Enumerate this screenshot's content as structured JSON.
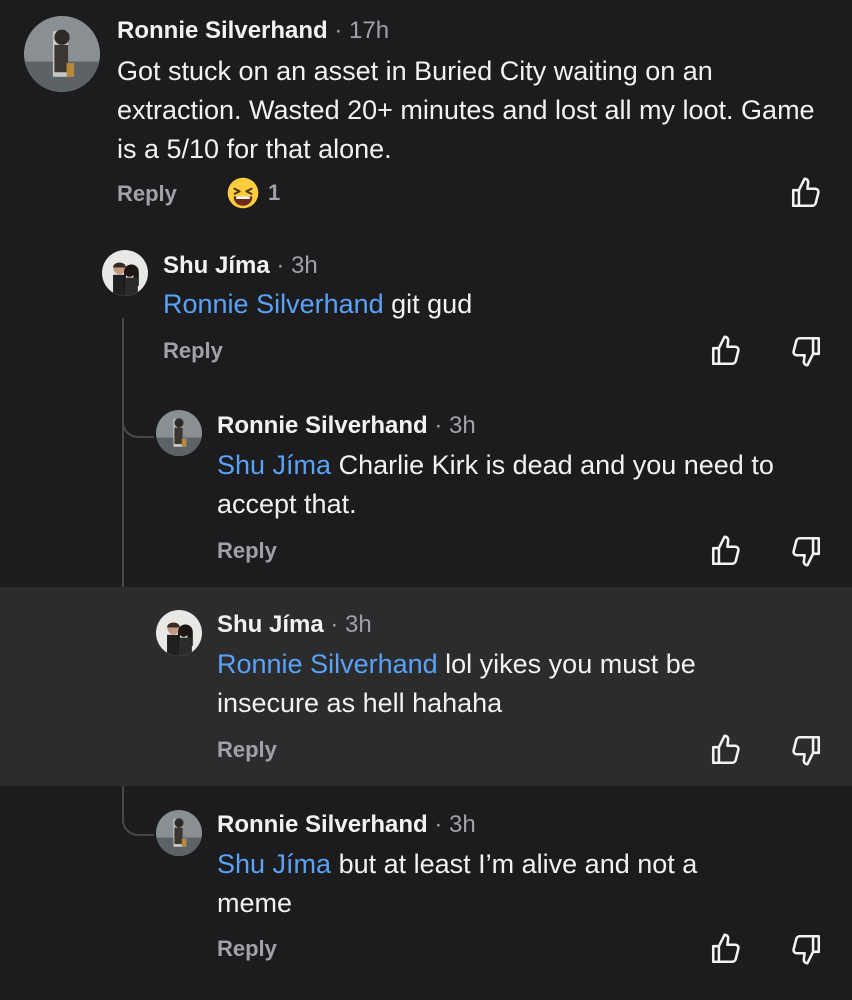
{
  "comments": [
    {
      "author": "Ronnie Silverhand",
      "time": "17h",
      "mention": "",
      "text": "Got stuck on an asset in Buried City waiting on an extraction. Wasted 20+ minutes and lost all my loot. Game is a 5/10 for that alone.",
      "reply_label": "Reply",
      "reaction_count": "1"
    },
    {
      "author": "Shu Jíma",
      "time": "3h",
      "mention": "Ronnie Silverhand",
      "text": " git gud",
      "reply_label": "Reply"
    },
    {
      "author": "Ronnie Silverhand",
      "time": "3h",
      "mention": "Shu Jíma",
      "text": " Charlie Kirk is dead and you need to accept that.",
      "reply_label": "Reply"
    },
    {
      "author": "Shu Jíma",
      "time": "3h",
      "mention": "Ronnie Silverhand",
      "text": " lol yikes you must be insecure as hell hahaha",
      "reply_label": "Reply"
    },
    {
      "author": "Ronnie Silverhand",
      "time": "3h",
      "mention": "Shu Jíma",
      "text": " but at least I’m alive and not a meme",
      "reply_label": "Reply"
    }
  ],
  "separator": "·",
  "icons": {
    "like": "thumbs-up-icon",
    "dislike": "thumbs-down-icon",
    "reaction": "laughing-emoji-icon"
  },
  "colors": {
    "background": "#1c1c1e",
    "highlight": "#2c2c2e",
    "mention": "#5aa2f7",
    "muted": "#a1a1a6"
  }
}
